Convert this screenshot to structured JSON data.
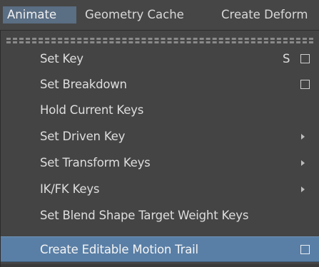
{
  "menubar": {
    "items": [
      {
        "label": "Animate",
        "active": true
      },
      {
        "label": "Geometry Cache",
        "active": false
      },
      {
        "label": "Create Deform",
        "active": false
      }
    ]
  },
  "dropdown": {
    "items": [
      {
        "label": "Set Key",
        "shortcut": "S",
        "option_box": true,
        "submenu": false,
        "highlighted": false
      },
      {
        "label": "Set Breakdown",
        "shortcut": "",
        "option_box": true,
        "submenu": false,
        "highlighted": false
      },
      {
        "label": "Hold Current Keys",
        "shortcut": "",
        "option_box": false,
        "submenu": false,
        "highlighted": false
      },
      {
        "label": "Set Driven Key",
        "shortcut": "",
        "option_box": false,
        "submenu": true,
        "highlighted": false
      },
      {
        "label": "Set Transform Keys",
        "shortcut": "",
        "option_box": false,
        "submenu": true,
        "highlighted": false
      },
      {
        "label": "IK/FK Keys",
        "shortcut": "",
        "option_box": false,
        "submenu": true,
        "highlighted": false
      },
      {
        "label": "Set Blend Shape Target Weight Keys",
        "shortcut": "",
        "option_box": false,
        "submenu": false,
        "highlighted": false
      },
      {
        "label": "Create Editable Motion Trail",
        "shortcut": "",
        "option_box": true,
        "submenu": false,
        "highlighted": true
      }
    ]
  },
  "colors": {
    "background": "#444444",
    "menubar_active": "#5a6e84",
    "highlight": "#5a7fa6",
    "text": "#dedede"
  },
  "icons": {
    "option_box": "option-box-icon",
    "submenu": "submenu-arrow-icon"
  }
}
